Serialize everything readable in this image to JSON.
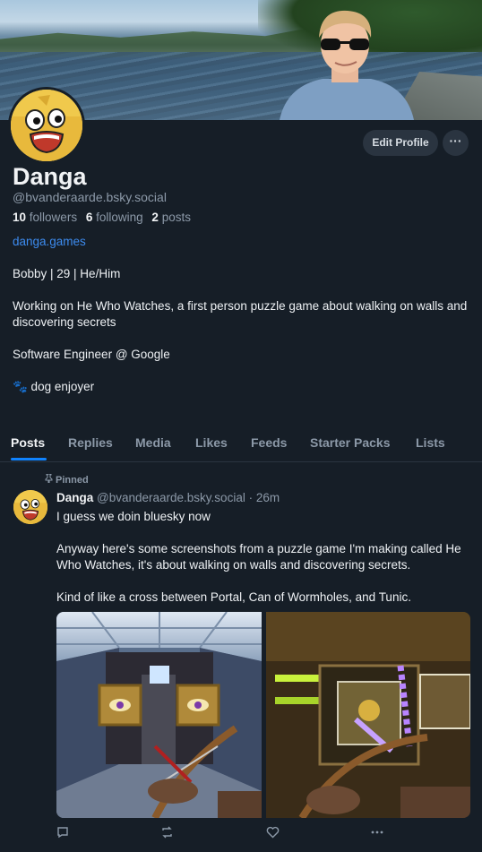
{
  "profile": {
    "display_name": "Danga",
    "handle": "@bvanderaarde.bsky.social",
    "followers_count": "10",
    "followers_label": "followers",
    "following_count": "6",
    "following_label": "following",
    "posts_count": "2",
    "posts_label": "posts",
    "edit_label": "Edit Profile",
    "more_label": "···",
    "website": "danga.games",
    "bio": [
      "Bobby | 29 | He/Him",
      "Working on He Who Watches, a first person puzzle game about walking on walls and discovering secrets",
      "Software Engineer @ Google",
      "🐾 dog enjoyer"
    ]
  },
  "tabs": [
    "Posts",
    "Replies",
    "Media",
    "Likes",
    "Feeds",
    "Starter Packs",
    "Lists"
  ],
  "post": {
    "pinned_label": "Pinned",
    "author": "Danga",
    "handle": "@bvanderaarde.bsky.social",
    "time": "· 26m",
    "paragraphs": [
      "I guess we doin bluesky now",
      "Anyway here's some screenshots from a puzzle game I'm making called He Who Watches, it's about walking on walls and discovering secrets.",
      "Kind of like a cross between Portal, Can of Wormholes, and Tunic."
    ]
  },
  "colors": {
    "background": "#161e27",
    "accent": "#1083fe",
    "link": "#3d8cf0",
    "muted": "#8c99a8"
  },
  "icons": [
    "reply-icon",
    "repost-icon",
    "like-icon",
    "more-icon",
    "pin-icon"
  ]
}
